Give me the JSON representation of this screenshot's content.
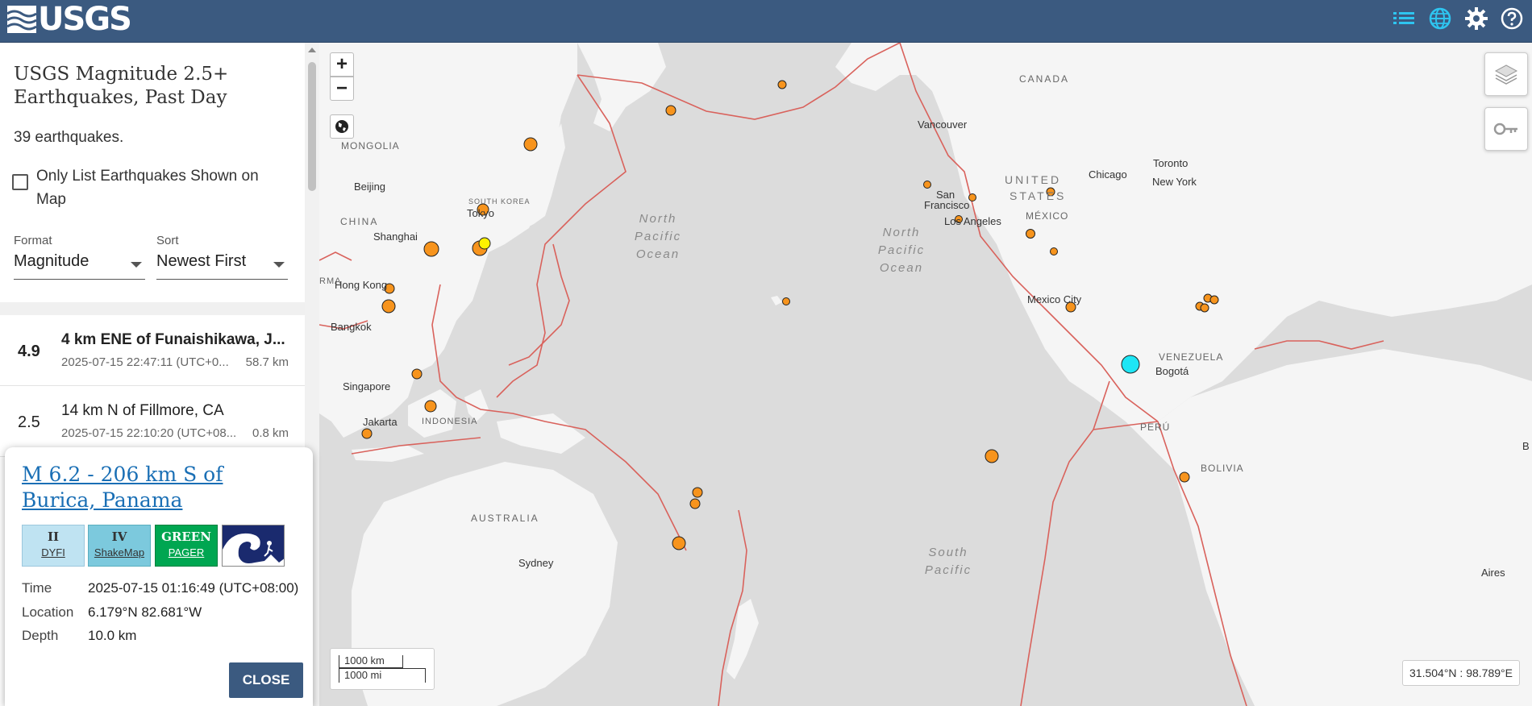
{
  "header": {
    "logo_text": "USGS",
    "icons": [
      "list-icon",
      "globe-icon",
      "gear-icon",
      "help-icon"
    ]
  },
  "sidebar": {
    "title": "USGS Magnitude 2.5+ Earthquakes, Past Day",
    "count_text": "39 earthquakes.",
    "only_list_label": "Only List Earthquakes Shown on Map",
    "format": {
      "caption": "Format",
      "value": "Magnitude"
    },
    "sort": {
      "caption": "Sort",
      "value": "Newest First"
    },
    "earthquakes": [
      {
        "mag": "4.9",
        "place": "4 km ENE of Funaishikawa, J...",
        "time": "2025-07-15 22:47:11 (UTC+0...",
        "depth": "58.7 km"
      },
      {
        "mag": "2.5",
        "place": "14 km N of Fillmore, CA",
        "time": "2025-07-15 22:10:20 (UTC+08...",
        "depth": "0.8 km"
      }
    ]
  },
  "popup": {
    "title": "M 6.2 - 206 km S of Burica, Panama",
    "dyfi": {
      "value": "II",
      "label": "DYFI"
    },
    "shakemap": {
      "value": "IV",
      "label": "ShakeMap"
    },
    "pager": {
      "value": "GREEN",
      "label": "PAGER"
    },
    "time_label": "Time",
    "time_value": "2025-07-15 01:16:49 (UTC+08:00)",
    "location_label": "Location",
    "location_value": "6.179°N 82.681°W",
    "depth_label": "Depth",
    "depth_value": "10.0 km",
    "close_label": "CLOSE"
  },
  "map": {
    "zoom_in": "+",
    "zoom_out": "−",
    "scale_km": "1000 km",
    "scale_mi": "1000 mi",
    "coords": "31.504°N : 98.789°E",
    "labels": {
      "canada": "CANADA",
      "mongolia": "MONGOLIA",
      "china": "CHINA",
      "united_states": "UNITED STATES",
      "mexico": "MÉXICO",
      "venezuela": "VENEZUELA",
      "peru": "PERÚ",
      "bolivia": "BOLIVIA",
      "australia": "AUSTRALIA",
      "indonesia": "INDONESIA",
      "burma": "RMA",
      "south_korea": "SOUTH KOREA",
      "north_pacific_1": "North Pacific Ocean",
      "north_pacific_2": "North Pacific Ocean",
      "south_pacific": "South Pacific",
      "vancouver": "Vancouver",
      "chicago": "Chicago",
      "toronto": "Toronto",
      "new_york": "New York",
      "san_francisco": "San Francisco",
      "los_angeles": "Los Angeles",
      "mexico_city": "Mexico City",
      "bogota": "Bogotá",
      "beijing": "Beijing",
      "shanghai": "Shanghai",
      "hong_kong": "Hong Kong",
      "bangkok": "Bangkok",
      "singapore": "Singapore",
      "jakarta": "Jakarta",
      "sydney": "Sydney",
      "tokyo": "Tokyo",
      "aires": "Aires",
      "b_edge": "B"
    },
    "colors": {
      "ocean": "#dcdcdc",
      "land": "#f5f5f5",
      "plate": "#d9625c",
      "quake": "#f7941d",
      "recent": "#fff200",
      "selected": "#1ee6f5"
    }
  }
}
